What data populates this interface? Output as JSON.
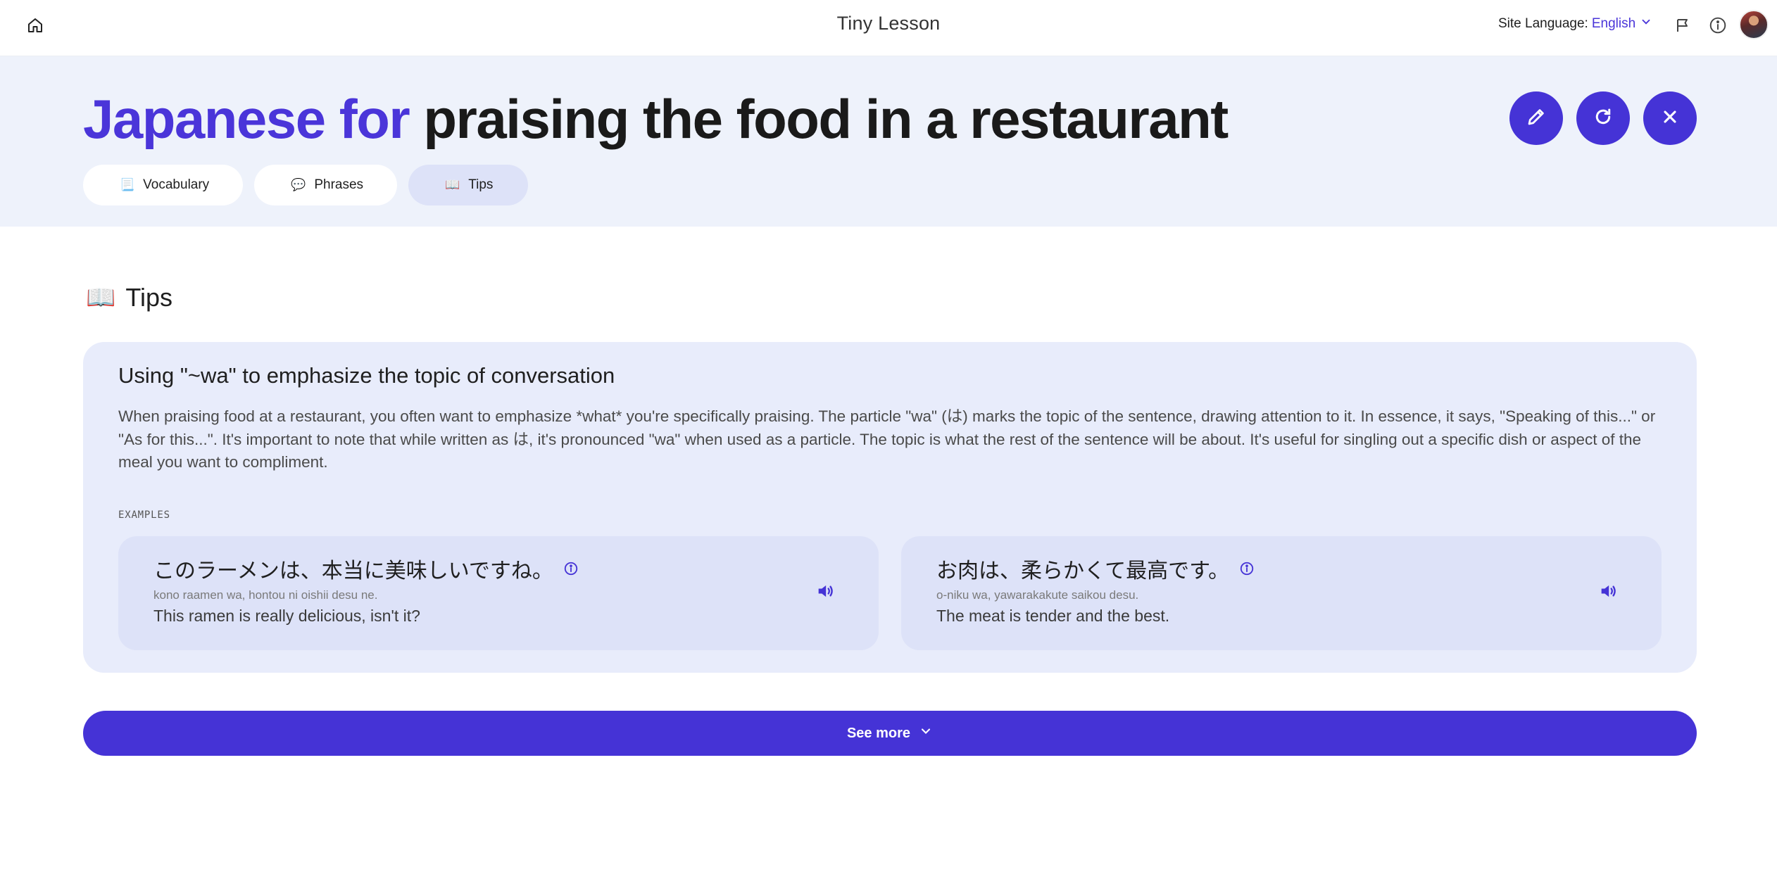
{
  "topbar": {
    "app_title": "Tiny Lesson",
    "site_language_label": "Site Language:",
    "site_language_value": "English"
  },
  "hero": {
    "title_accent": "Japanese for",
    "title_rest": "praising the food in a restaurant",
    "tabs": [
      {
        "icon": "📃",
        "label": "Vocabulary",
        "active": false
      },
      {
        "icon": "💬",
        "label": "Phrases",
        "active": false
      },
      {
        "icon": "📖",
        "label": "Tips",
        "active": true
      }
    ]
  },
  "section": {
    "icon": "📖",
    "heading": "Tips"
  },
  "tip": {
    "title": "Using \"~wa\" to emphasize the topic of conversation",
    "body": "When praising food at a restaurant, you often want to emphasize *what* you're specifically praising. The particle \"wa\" (は) marks the topic of the sentence, drawing attention to it. In essence, it says, \"Speaking of this...\" or \"As for this...\". It's important to note that while written as は, it's pronounced \"wa\" when used as a particle. The topic is what the rest of the sentence will be about. It's useful for singling out a specific dish or aspect of the meal you want to compliment.",
    "examples_label": "EXAMPLES",
    "examples": [
      {
        "japanese": "このラーメンは、本当に美味しいですね。",
        "romaji": "kono raamen wa, hontou ni oishii desu ne.",
        "english": "This ramen is really delicious, isn't it?"
      },
      {
        "japanese": "お肉は、柔らかくて最高です。",
        "romaji": "o-niku wa, yawarakakute saikou desu.",
        "english": "The meat is tender and the best."
      }
    ]
  },
  "see_more_label": "See more",
  "colors": {
    "accent": "#4533d6",
    "hero_bg": "#eef2fb",
    "card_bg": "#e8ecfb",
    "example_bg": "#dde2f8"
  }
}
